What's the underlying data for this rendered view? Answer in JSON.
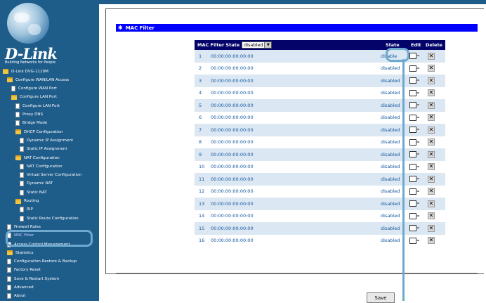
{
  "sidebar": {
    "brand": "D-Link",
    "tagline": "Building Networks for People",
    "items": [
      {
        "label": "D-Link DVG-1120M",
        "icon": "folder"
      },
      {
        "label": "Configure WAN/LAN Access",
        "icon": "folder"
      },
      {
        "label": "Configure WAN Port",
        "icon": "page"
      },
      {
        "label": "Configure LAN Port",
        "icon": "folder"
      },
      {
        "label": "Configure LAN Port",
        "icon": "page"
      },
      {
        "label": "Proxy DNS",
        "icon": "page"
      },
      {
        "label": "Bridge Mode",
        "icon": "page"
      },
      {
        "label": "DHCP Configuration",
        "icon": "folder"
      },
      {
        "label": "Dynamic IP Assignment",
        "icon": "page"
      },
      {
        "label": "Static IP Assignment",
        "icon": "page"
      },
      {
        "label": "NAT Configuration",
        "icon": "folder"
      },
      {
        "label": "NAT Configuration",
        "icon": "page"
      },
      {
        "label": "Virtual Server Configuration",
        "icon": "page"
      },
      {
        "label": "Dynamic NAT",
        "icon": "page"
      },
      {
        "label": "Static NAT",
        "icon": "page"
      },
      {
        "label": "Routing",
        "icon": "folder"
      },
      {
        "label": "RIP",
        "icon": "page"
      },
      {
        "label": "Static Route Configuration",
        "icon": "page"
      },
      {
        "label": "Firewall Rules",
        "icon": "page"
      },
      {
        "label": "MAC Filter",
        "icon": "page"
      },
      {
        "label": "Access Control Management",
        "icon": "page"
      },
      {
        "label": "Statistics",
        "icon": "folder"
      },
      {
        "label": "Configuration Restore & Backup",
        "icon": "page"
      },
      {
        "label": "Factory Reset",
        "icon": "page"
      },
      {
        "label": "Save & Restart System",
        "icon": "page"
      },
      {
        "label": "Advanced",
        "icon": "page"
      },
      {
        "label": "About",
        "icon": "page"
      }
    ]
  },
  "main": {
    "title": "MAC Filter",
    "state_label": "MAC Filter State",
    "state_value": "disabled",
    "headers": {
      "state": "State",
      "edit": "Edit",
      "delete": "Delete"
    },
    "rows": [
      {
        "num": "1",
        "mac": "00:00:00:00:00:00",
        "state": "disable"
      },
      {
        "num": "2",
        "mac": "00:00:00:00:00:00",
        "state": "disabled"
      },
      {
        "num": "3",
        "mac": "00:00:00:00:00:00",
        "state": "disabled"
      },
      {
        "num": "4",
        "mac": "00:00:00:00:00:00",
        "state": "disabled"
      },
      {
        "num": "5",
        "mac": "00:00:00:00:00:00",
        "state": "disabled"
      },
      {
        "num": "6",
        "mac": "00:00:00:00:00:00",
        "state": "disabled"
      },
      {
        "num": "7",
        "mac": "00:00:00:00:00:00",
        "state": "disabled"
      },
      {
        "num": "8",
        "mac": "00:00:00:00:00:00",
        "state": "disabled"
      },
      {
        "num": "9",
        "mac": "00:00:00:00:00:00",
        "state": "disabled"
      },
      {
        "num": "10",
        "mac": "00:00:00:00:00:00",
        "state": "disabled"
      },
      {
        "num": "11",
        "mac": "00:00:00:00:00:00",
        "state": "disabled"
      },
      {
        "num": "12",
        "mac": "00:00:00:00:00:00",
        "state": "disabled"
      },
      {
        "num": "13",
        "mac": "00:00:00:00:00:00",
        "state": "disabled"
      },
      {
        "num": "14",
        "mac": "00:00:00:00:00:00",
        "state": "disabled"
      },
      {
        "num": "15",
        "mac": "00:00:00:00:00:00",
        "state": "disabled"
      },
      {
        "num": "16",
        "mac": "00:00:00:00:00:00",
        "state": "disabled"
      }
    ],
    "save_label": "Save",
    "delete_glyph": "✕",
    "title_glyph": "✱"
  },
  "colors": {
    "sidebar": "#1e5c8a",
    "header": "#0000ff",
    "table_head": "#03036a",
    "highlight": "#6fa9d0"
  }
}
